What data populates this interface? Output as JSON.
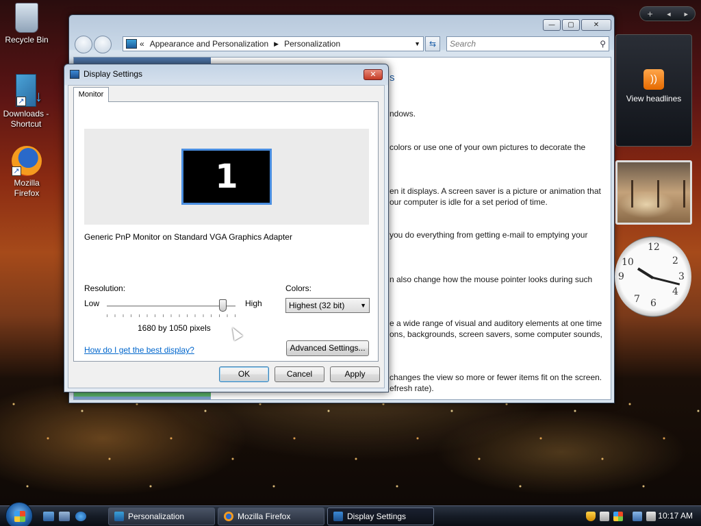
{
  "desktop": {
    "icons": [
      {
        "label": "Recycle Bin"
      },
      {
        "label": "Downloads - Shortcut"
      },
      {
        "label": "Mozilla Firefox"
      }
    ]
  },
  "explorer": {
    "address": {
      "chevron": "«",
      "crumb1": "Appearance and Personalization",
      "crumb2": "Personalization"
    },
    "search_placeholder": "Search",
    "header_fragment": "s",
    "text_fragments": [
      "ndows.",
      "colors or use one of your own pictures to decorate the",
      "en it displays. A screen saver is a picture or animation that",
      "our computer is idle for a set period of time.",
      "you do everything from getting e-mail to emptying your",
      "n also change how the mouse pointer looks during such",
      "e a wide range of visual and auditory elements at one time",
      "ons, backgrounds, screen savers, some computer sounds,",
      "changes the view so more or fewer items fit on the screen.",
      "efresh rate)."
    ]
  },
  "sidebar": {
    "feed_label": "View headlines"
  },
  "dialog": {
    "title": "Display Settings",
    "tab_label": "Monitor",
    "monitor_number": "1",
    "monitor_name": "Generic PnP Monitor on Standard VGA Graphics Adapter",
    "resolution_label": "Resolution:",
    "low_label": "Low",
    "high_label": "High",
    "resolution_value": "1680 by 1050 pixels",
    "resolution_slider_fraction": 0.9,
    "colors_label": "Colors:",
    "colors_value": "Highest (32 bit)",
    "help_link": "How do I get the best display?",
    "advanced_button": "Advanced Settings...",
    "ok_button": "OK",
    "cancel_button": "Cancel",
    "apply_button": "Apply"
  },
  "taskbar": {
    "tasks": [
      {
        "label": "Personalization"
      },
      {
        "label": "Mozilla Firefox"
      },
      {
        "label": "Display Settings"
      }
    ],
    "clock": "10:17 AM"
  },
  "colors": {
    "accent_blue": "#4a8ee0",
    "link_blue": "#0066cc",
    "close_red": "#c43a24"
  }
}
